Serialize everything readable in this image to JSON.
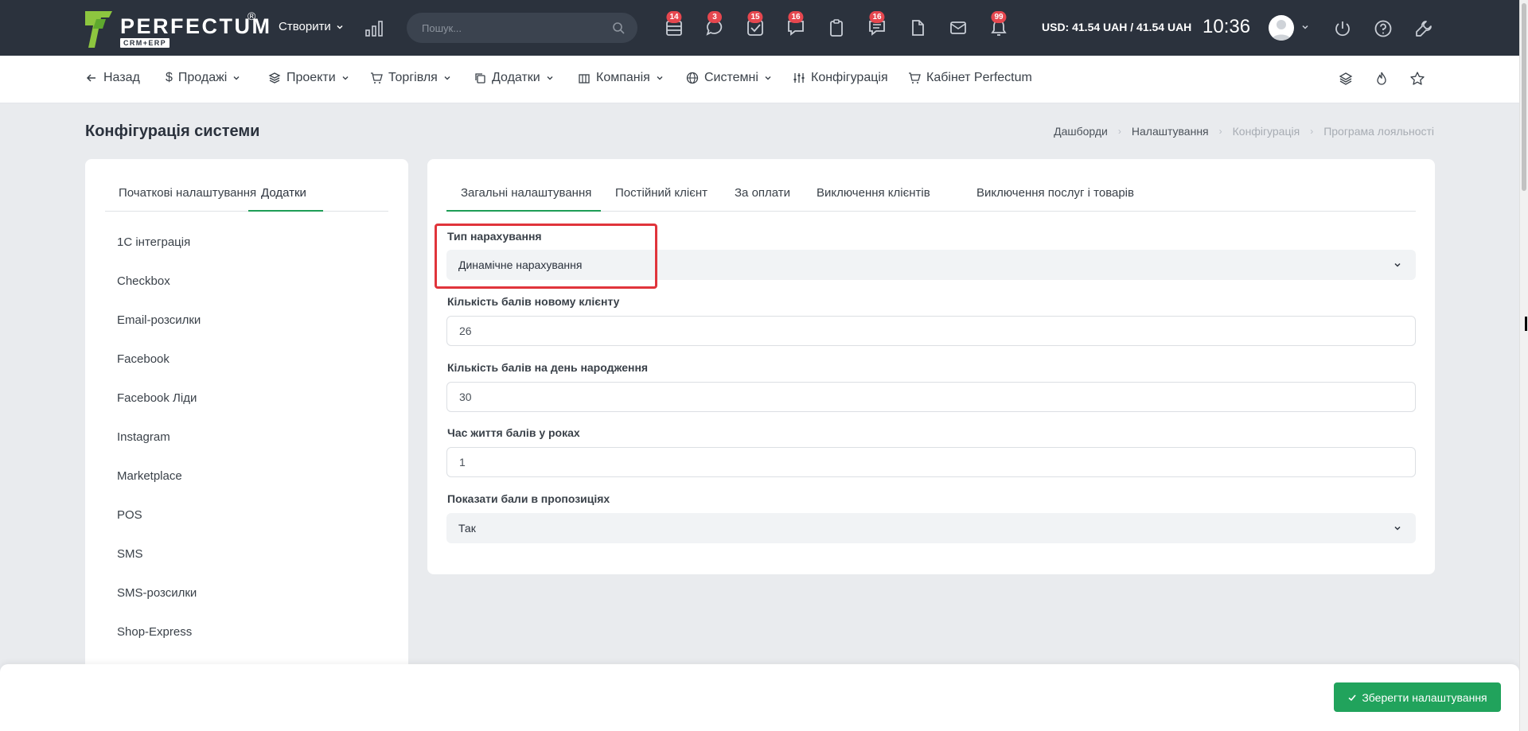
{
  "app": {
    "logo_text": "PERFECTUM",
    "logo_reg": "®",
    "logo_sub": "CRM+ERP",
    "create_label": "Створити",
    "search_placeholder": "Пошук...",
    "badges": {
      "b1": "14",
      "b2": "3",
      "b3": "15",
      "b4": "16",
      "b5": "16",
      "b6": "99"
    },
    "currency": "USD: 41.54 UAH / 41.54 UAH",
    "clock": "10:36"
  },
  "nav": {
    "back": "Назад",
    "sales": "Продажі",
    "projects": "Проекти",
    "trade": "Торгівля",
    "addons": "Додатки",
    "company": "Компанія",
    "system": "Системні",
    "config": "Конфігурація",
    "cabinet": "Кабінет Perfectum"
  },
  "page": {
    "title": "Конфігурація системи",
    "breadcrumb": [
      "Дашборди",
      "Налаштування",
      "Конфігурація",
      "Програма лояльності"
    ]
  },
  "left": {
    "tabs": [
      "Початкові налаштування",
      "Додатки"
    ],
    "items": [
      "1С інтеграція",
      "Checkbox",
      "Email-розсилки",
      "Facebook",
      "Facebook Ліди",
      "Instagram",
      "Marketplace",
      "POS",
      "SMS",
      "SMS-розсилки",
      "Shop-Express"
    ]
  },
  "right": {
    "tabs": [
      "Загальні налаштування",
      "Постійний клієнт",
      "За оплати",
      "Виключення клієнтів",
      "Виключення послуг і товарів"
    ],
    "fields": {
      "accrual_type_label": "Тип нарахування",
      "accrual_type_value": "Динамічне нарахування",
      "new_client_points_label": "Кількість балів новому клієнту",
      "new_client_points_value": "26",
      "birthday_points_label": "Кількість балів на день народження",
      "birthday_points_value": "30",
      "points_lifetime_label": "Час життя балів у роках",
      "points_lifetime_value": "1",
      "show_points_label": "Показати бали в пропозиціях",
      "show_points_value": "Так"
    }
  },
  "footer": {
    "save_label": "Зберегти налаштування"
  },
  "colors": {
    "topbar": "#2b323d",
    "accent": "#1e9d56",
    "badge": "#e6474f",
    "highlight": "#e0343b",
    "save": "#21a35c"
  }
}
